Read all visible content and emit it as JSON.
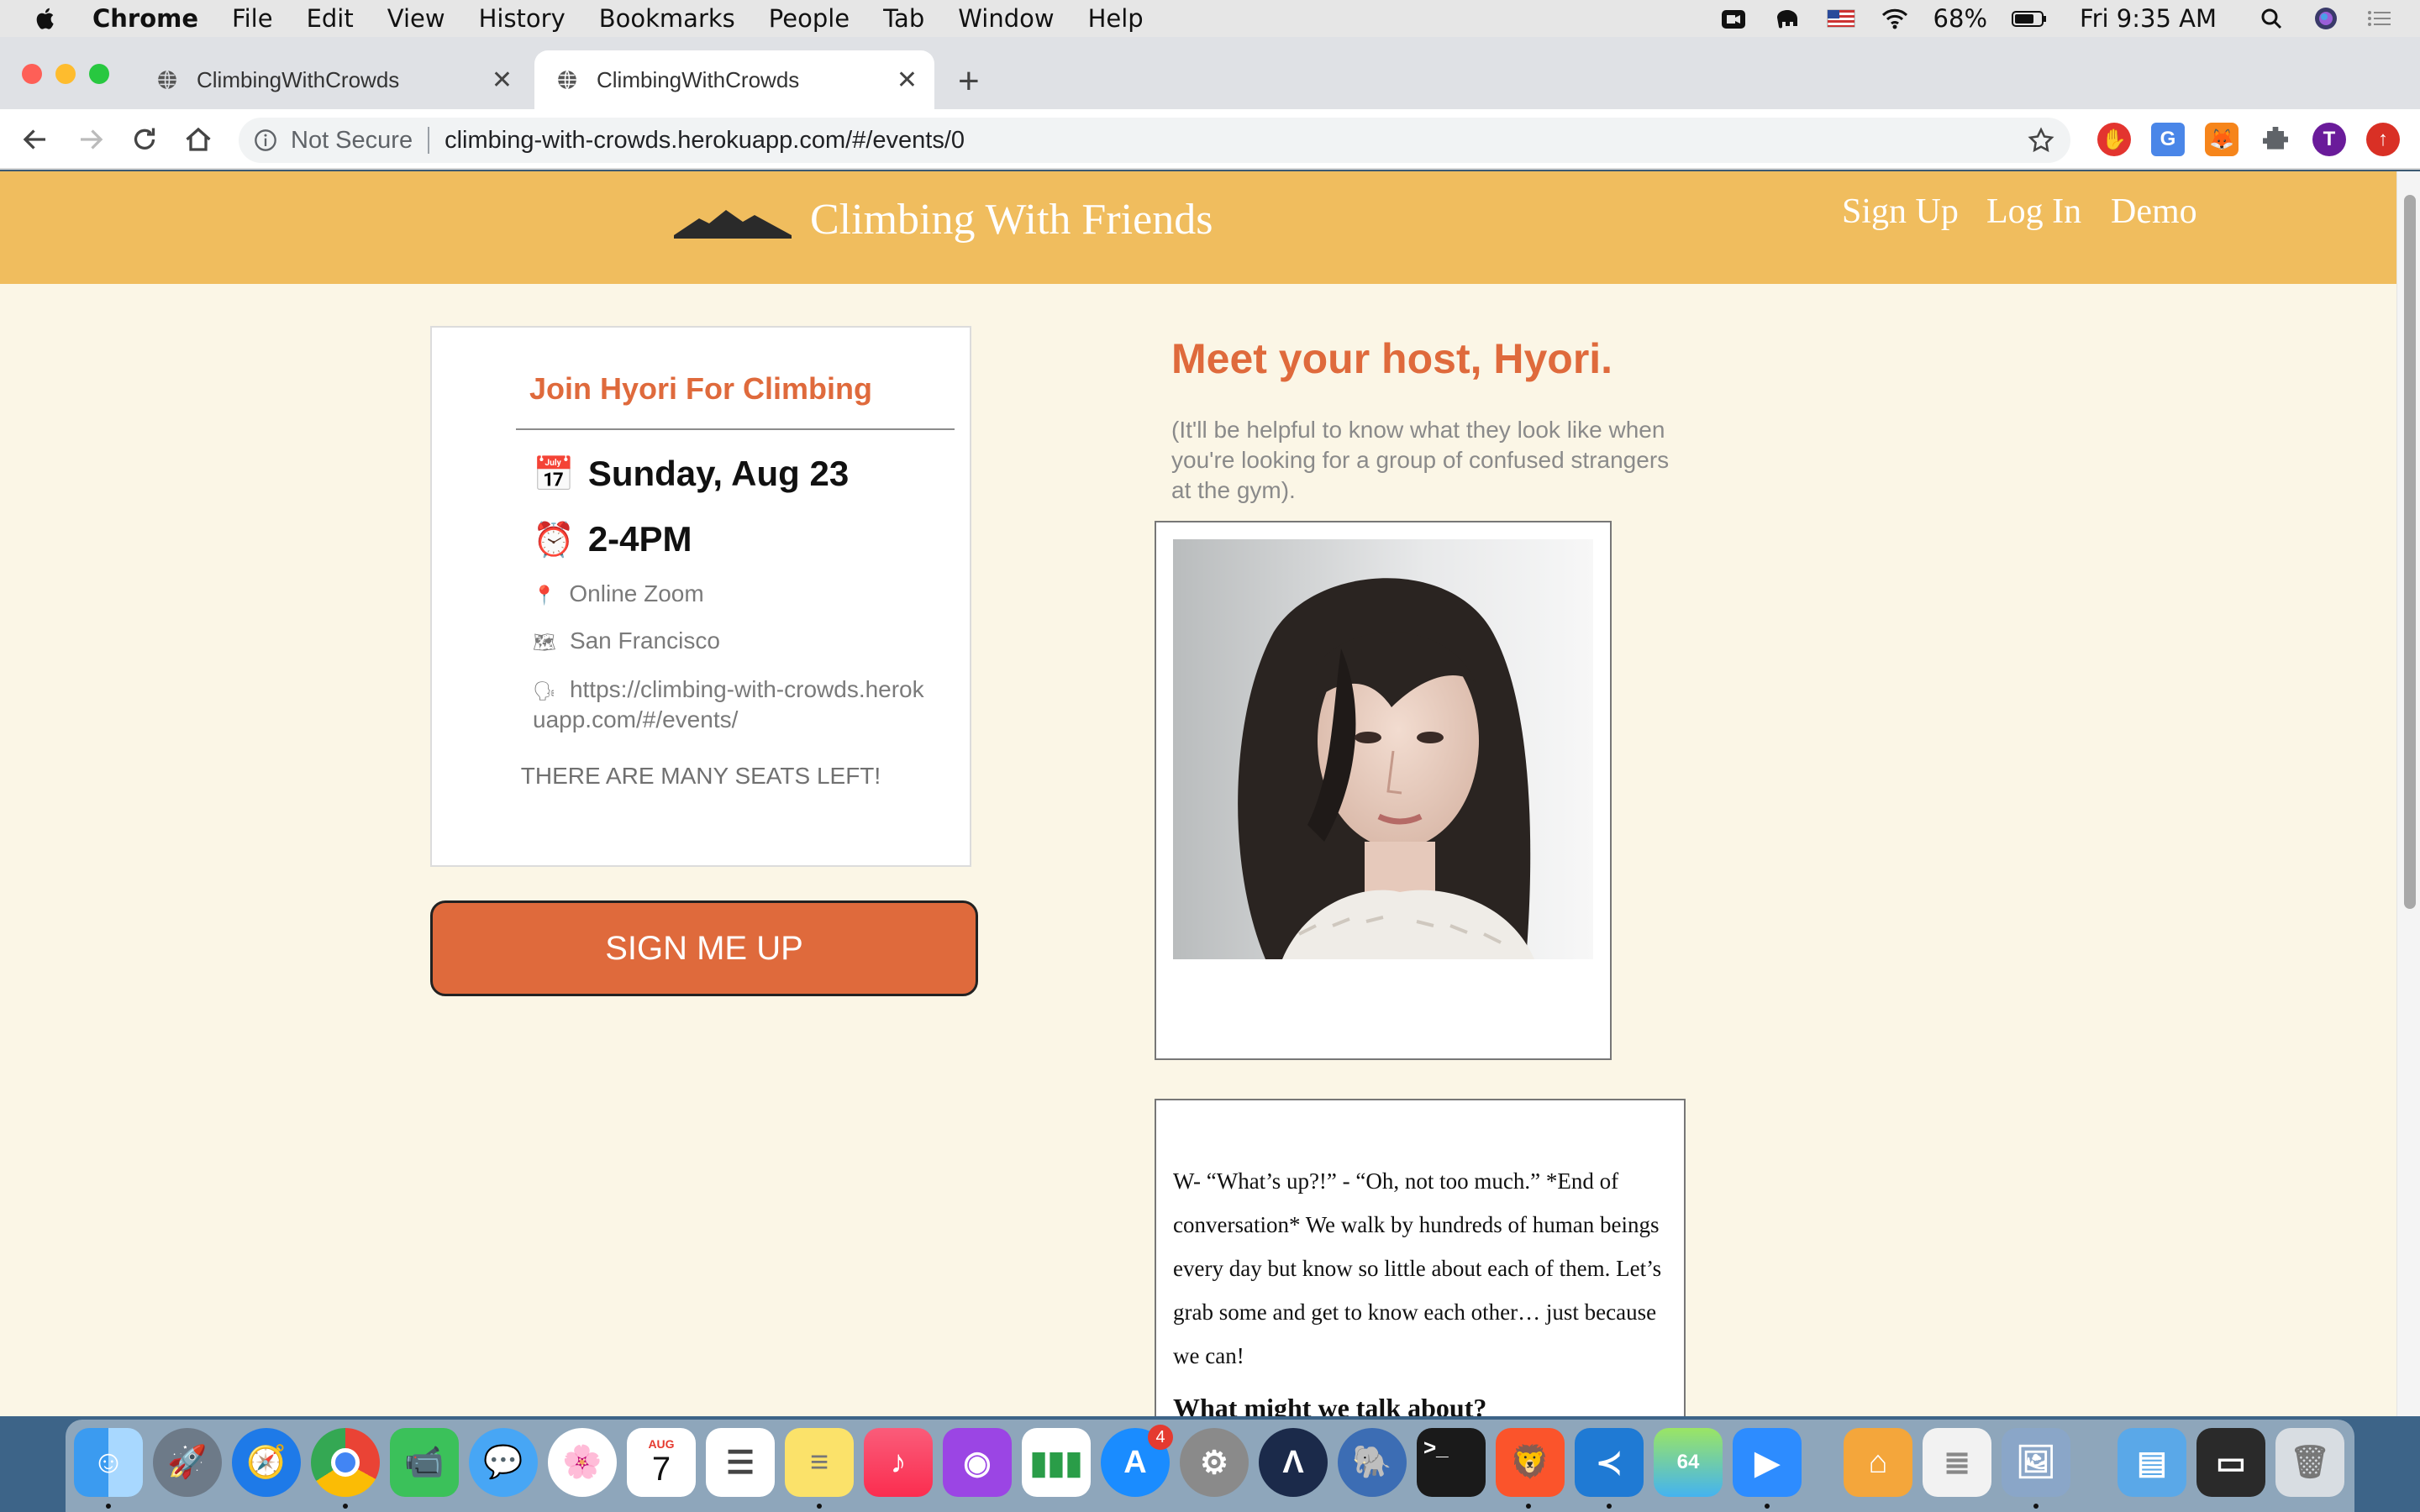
{
  "menubar": {
    "app_name": "Chrome",
    "items": [
      "File",
      "Edit",
      "View",
      "History",
      "Bookmarks",
      "People",
      "Tab",
      "Window",
      "Help"
    ],
    "battery": "68%",
    "clock": "Fri 9:35 AM"
  },
  "browser": {
    "tabs": [
      {
        "title": "ClimbingWithCrowds",
        "active": false
      },
      {
        "title": "ClimbingWithCrowds",
        "active": true
      }
    ],
    "security_label": "Not Secure",
    "url": "climbing-with-crowds.herokuapp.com/#/events/0",
    "profile_initial": "T"
  },
  "site": {
    "title": "Climbing With Friends",
    "nav": [
      "Sign Up",
      "Log In",
      "Demo"
    ]
  },
  "event": {
    "title": "Join Hyori For Climbing",
    "date": "Sunday, Aug 23",
    "time": "2-4PM",
    "location": "Online Zoom",
    "city": "San Francisco",
    "link": "https://climbing-with-crowds.herokuapp.com/#/events/",
    "seats": "THERE ARE MANY SEATS LEFT!",
    "signup_label": "SIGN ME UP",
    "icons": {
      "date": "calendar-icon",
      "time": "alarm-clock-icon",
      "location": "pin-icon",
      "city": "map-icon",
      "link": "speaking-head-icon"
    }
  },
  "host": {
    "heading": "Meet your host, Hyori.",
    "subtext": "(It'll be helpful to know what they look like when you're looking for a group of confused strangers at the gym).",
    "bio": "W- “What’s up?!” - “Oh, not too much.” *End of conversation* We walk by hundreds of human beings every day but know so little about each of them. Let’s grab some and get to know each other… just because we can!",
    "bio_heading": "What might we talk about?"
  },
  "dock": {
    "calendar_month": "AUG",
    "calendar_day": "7",
    "appstore_badge": "4"
  },
  "colors": {
    "header": "#f0bd5e",
    "accent": "#df6a3c",
    "page_bg": "#fbf6e6"
  }
}
